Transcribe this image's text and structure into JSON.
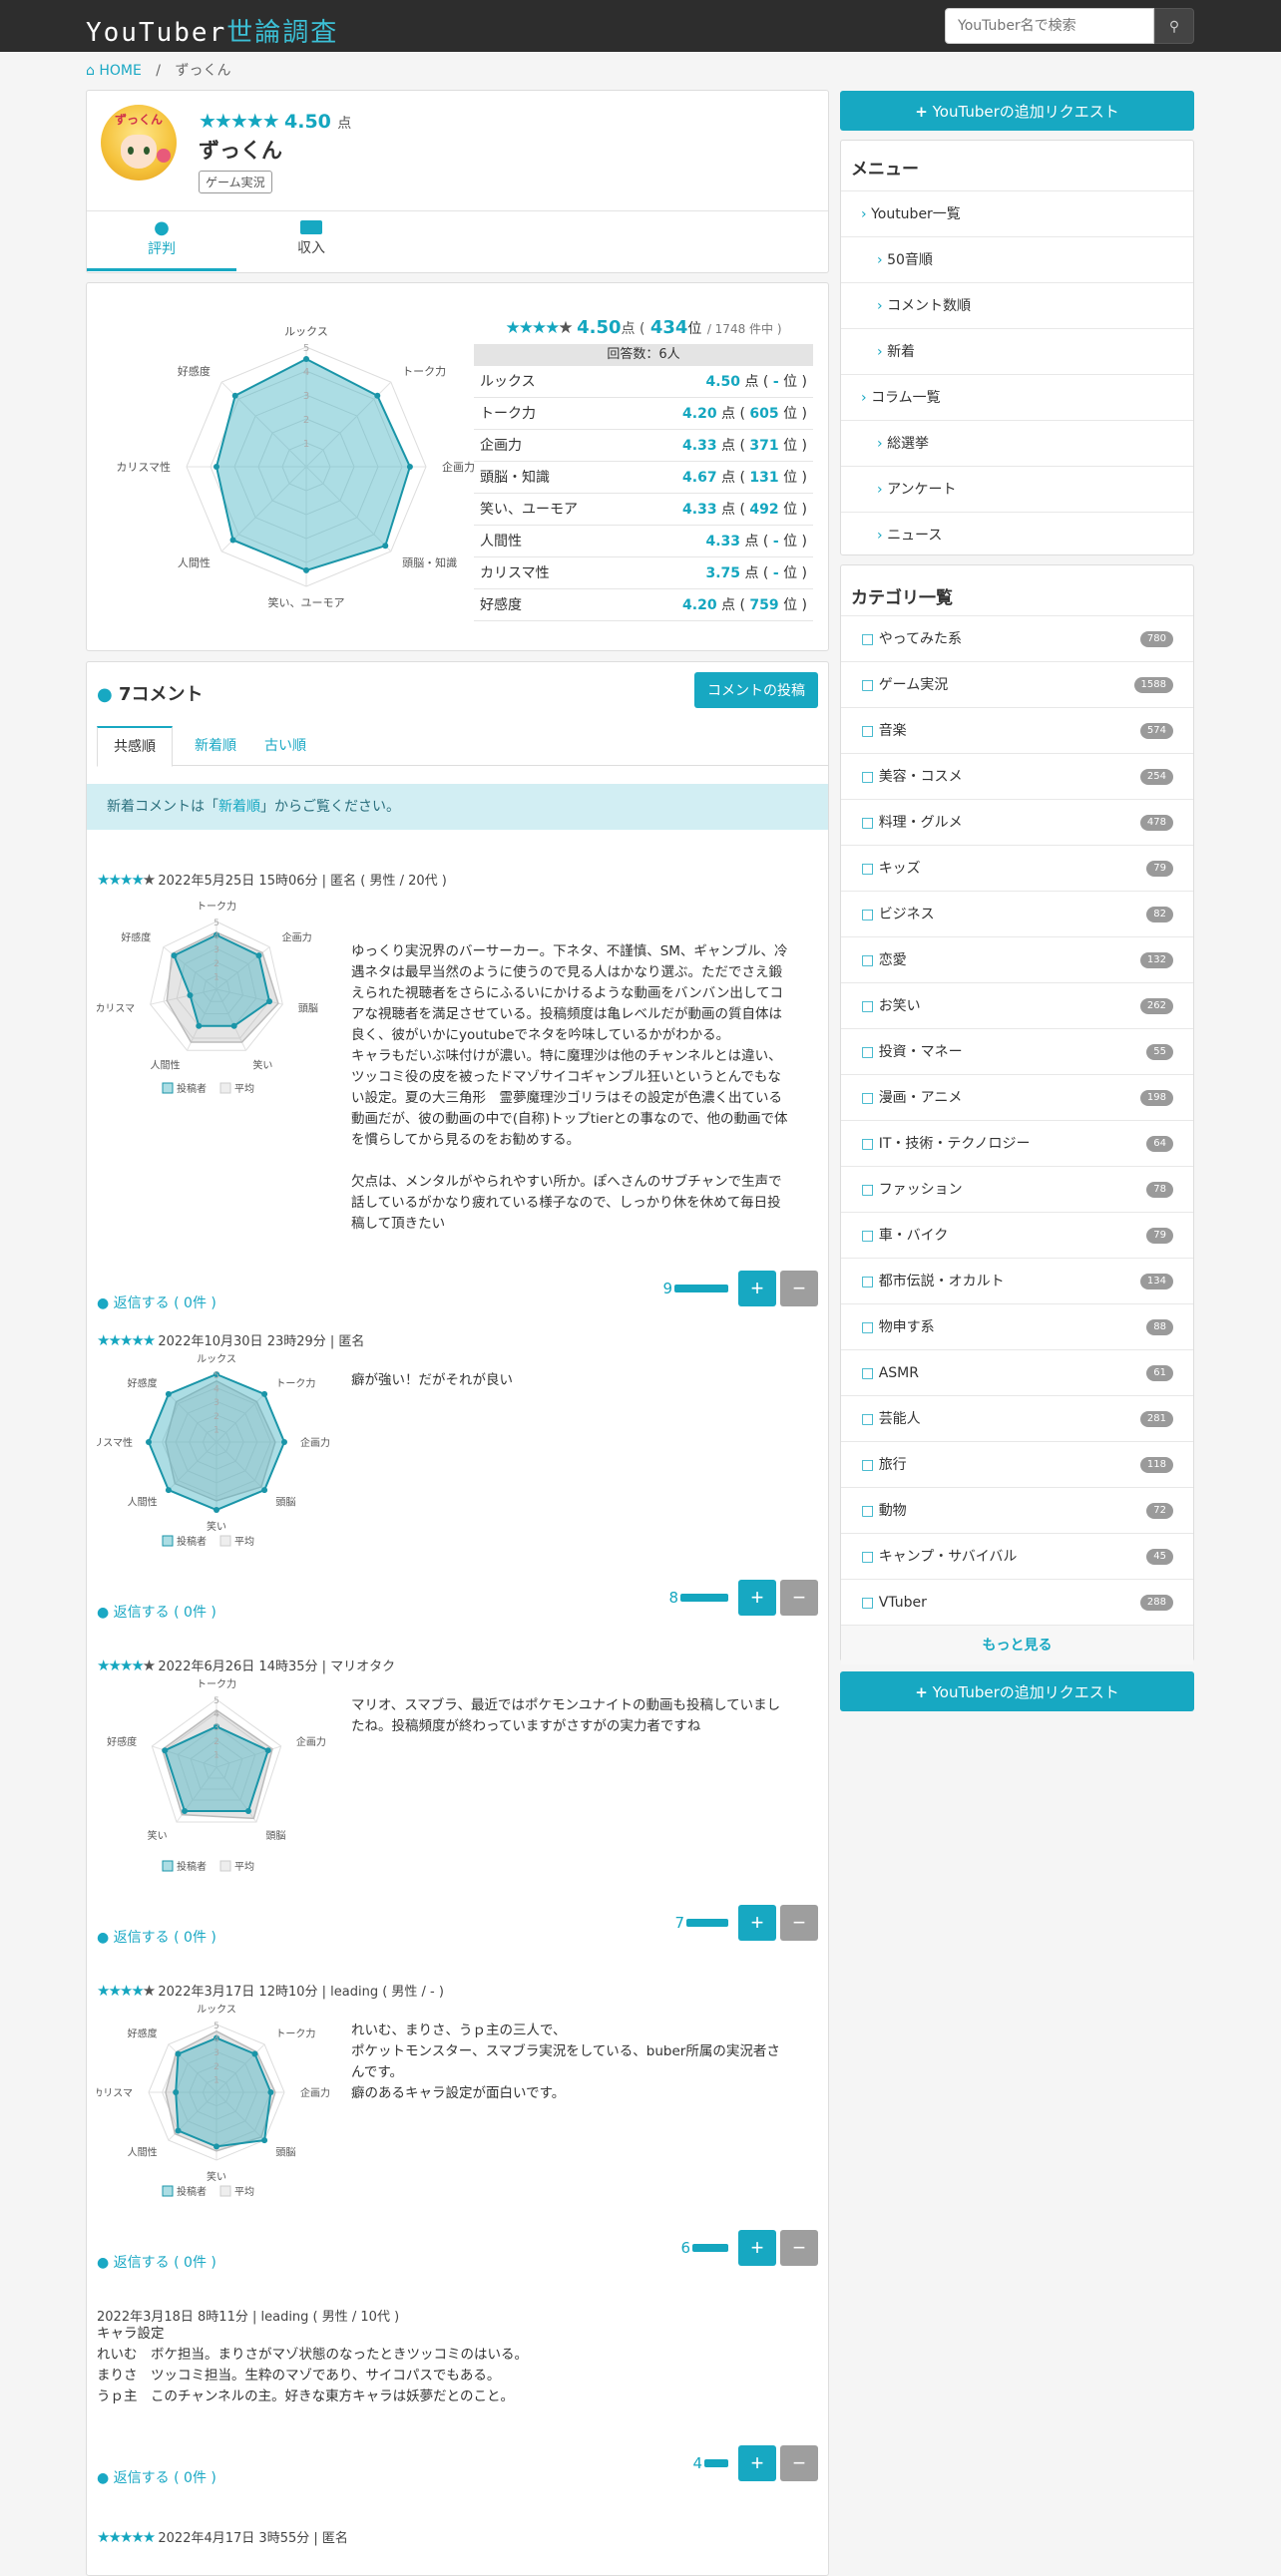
{
  "header": {
    "logo_a": "YouTuber",
    "logo_b": "世論調査",
    "search_placeholder": "YouTuber名で検索",
    "search_icon": "search-icon"
  },
  "breadcrumb": {
    "home": "HOME",
    "sep": "/",
    "current": "ずっくん"
  },
  "profile": {
    "avatar_text": "ずっくん",
    "stars": "★★★★★",
    "score": "4.50",
    "score_unit": "点",
    "name": "ずっくん",
    "category": "ゲーム実況",
    "tab_review": "評判",
    "tab_income": "収入"
  },
  "summary": {
    "score": "4.50",
    "unit": "点 (",
    "rank": "434",
    "rank_unit": "位",
    "of": "/ 1748 件中 )",
    "respondents": "回答数：6人",
    "rows": [
      {
        "label": "ルックス",
        "score": "4.50",
        "rank": "-"
      },
      {
        "label": "トーク力",
        "score": "4.20",
        "rank": "605"
      },
      {
        "label": "企画力",
        "score": "4.33",
        "rank": "371"
      },
      {
        "label": "頭脳・知識",
        "score": "4.67",
        "rank": "131"
      },
      {
        "label": "笑い、ユーモア",
        "score": "4.33",
        "rank": "492"
      },
      {
        "label": "人間性",
        "score": "4.33",
        "rank": "-"
      },
      {
        "label": "カリスマ性",
        "score": "3.75",
        "rank": "-"
      },
      {
        "label": "好感度",
        "score": "4.20",
        "rank": "759"
      }
    ],
    "radar_labels": [
      "ルックス",
      "トーク力",
      "企画力",
      "頭脳・知識",
      "笑い、ユーモア",
      "人間性",
      "カリスマ性",
      "好感度"
    ],
    "radar_values": [
      4.5,
      4.2,
      4.33,
      4.67,
      4.33,
      4.33,
      3.75,
      4.2
    ]
  },
  "comments": {
    "title": "7コメント",
    "post_button": "コメントの投稿",
    "tabs": [
      "共感順",
      "新着順",
      "古い順"
    ],
    "notice_a": "新着コメントは「",
    "notice_link": "新着順",
    "notice_b": "」からご覧ください。",
    "legend_poster": "投稿者",
    "legend_avg": "平均",
    "items": [
      {
        "stars": "★★★★",
        "stars_g": "★",
        "meta": "2022年5月25日 15時06分 | 匿名 ( 男性 / 20代 )",
        "body": "ゆっくり実況界のバーサーカー。下ネタ、不謹慎、SM、ギャンブル、冷遇ネタは最早当然のように使うので見る人はかなり選ぶ。ただでさえ鍛えられた視聴者をさらにふるいにかけるような動画をバンバン出してコアな視聴者を満足させている。投稿頻度は亀レベルだが動画の質自体は良く、彼がいかにyoutubeでネタを吟味しているかがわかる。\nキャラもだいぶ味付けが濃い。特に魔理沙は他のチャンネルとは違い、ツッコミ役の皮を被ったドマゾサイコギャンブル狂いというとんでもない設定。夏の大三角形　霊夢魔理沙ゴリラはその設定が色濃く出ている動画だが、彼の動画の中で(自称)トップtierとの事なので、他の動画で体を慣らしてから見るのをお勧めする。\n\n欠点は、メンタルがやられやすい所か。ぽへさんのサブチャンで生声で話しているがかなり疲れている様子なので、しっかり休を休めて毎日投稿して頂きたい",
        "reply": "返信する ( 0件 )",
        "votes": "9",
        "radar_labels": [
          "トーク力",
          "企画力",
          "頭脳",
          "笑い",
          "人間性",
          "カリスマ",
          "好感度"
        ],
        "radar_values": [
          4,
          4,
          4,
          3,
          3,
          2,
          4
        ]
      },
      {
        "stars": "★★★★★",
        "stars_g": "",
        "meta": "2022年10月30日 23時29分 | 匿名",
        "body": "癖が強い！だがそれが良い",
        "reply": "返信する ( 0件 )",
        "votes": "8",
        "radar_labels": [
          "ルックス",
          "トーク力",
          "企画力",
          "頭脳",
          "笑い",
          "人間性",
          "カリスマ性",
          "好感度"
        ],
        "radar_values": [
          5,
          5,
          5,
          5,
          5,
          5,
          5,
          5
        ]
      },
      {
        "stars": "★★★★",
        "stars_g": "★",
        "meta": "2022年6月26日 14時35分 | マリオタク",
        "body": "マリオ、スマブラ、最近ではポケモンユナイトの動画も投稿していましたね。投稿頻度が終わっていますがさすがの実力者ですね",
        "reply": "返信する ( 0件 )",
        "votes": "7",
        "radar_labels": [
          "トーク力",
          "企画力",
          "頭脳",
          "笑い",
          "好感度"
        ],
        "radar_values": [
          3,
          4,
          4,
          4,
          4
        ]
      },
      {
        "stars": "★★★★",
        "stars_g": "★",
        "meta": "2022年3月17日 12時10分 | leading ( 男性 / - )",
        "body": "れいむ、まりさ、うｐ主の三人で、\nポケットモンスター、スマブラ実況をしている、buber所属の実況者さんです。\n癖のあるキャラ設定が面白いです。",
        "reply": "返信する ( 0件 )",
        "votes": "6",
        "radar_labels": [
          "ルックス",
          "トーク力",
          "企画力",
          "頭脳",
          "笑い",
          "人間性",
          "カリスマ",
          "好感度"
        ],
        "radar_values": [
          4,
          4,
          4,
          5,
          4,
          4,
          3,
          4
        ]
      },
      {
        "stars": "",
        "stars_g": "",
        "meta": "2022年3月18日 8時11分 | leading ( 男性 / 10代 )",
        "body": "キャラ設定\nれいむ　ボケ担当。まりさがマゾ状態のなったときツッコミのはいる。\nまりさ　ツッコミ担当。生粋のマゾであり、サイコパスでもある。\nうｐ主　このチャンネルの主。好きな東方キャラは妖夢だとのこと。",
        "reply": "返信する ( 0件 )",
        "votes": "4"
      },
      {
        "stars": "★★★★★",
        "stars_g": "",
        "meta": "2022年4月17日 3時55分 | 匿名"
      }
    ]
  },
  "sidebar": {
    "request_button": "YouTuberの追加リクエスト",
    "menu_title": "メニュー",
    "menu": [
      {
        "label": "Youtuber一覧",
        "indent": 0
      },
      {
        "label": "50音順",
        "indent": 1
      },
      {
        "label": "コメント数順",
        "indent": 1
      },
      {
        "label": "新着",
        "indent": 1
      },
      {
        "label": "コラム一覧",
        "indent": 0
      },
      {
        "label": "総選挙",
        "indent": 1
      },
      {
        "label": "アンケート",
        "indent": 1
      },
      {
        "label": "ニュース",
        "indent": 1
      }
    ],
    "category_title": "カテゴリ一覧",
    "categories": [
      {
        "label": "やってみた系",
        "count": "780"
      },
      {
        "label": "ゲーム実況",
        "count": "1588"
      },
      {
        "label": "音楽",
        "count": "574"
      },
      {
        "label": "美容・コスメ",
        "count": "254"
      },
      {
        "label": "料理・グルメ",
        "count": "478"
      },
      {
        "label": "キッズ",
        "count": "79"
      },
      {
        "label": "ビジネス",
        "count": "82"
      },
      {
        "label": "恋愛",
        "count": "132"
      },
      {
        "label": "お笑い",
        "count": "262"
      },
      {
        "label": "投資・マネー",
        "count": "55"
      },
      {
        "label": "漫画・アニメ",
        "count": "198"
      },
      {
        "label": "IT・技術・テクノロジー",
        "count": "64"
      },
      {
        "label": "ファッション",
        "count": "78"
      },
      {
        "label": "車・バイク",
        "count": "79"
      },
      {
        "label": "都市伝説・オカルト",
        "count": "134"
      },
      {
        "label": "物申す系",
        "count": "88"
      },
      {
        "label": "ASMR",
        "count": "61"
      },
      {
        "label": "芸能人",
        "count": "281"
      },
      {
        "label": "旅行",
        "count": "118"
      },
      {
        "label": "動物",
        "count": "72"
      },
      {
        "label": "キャンプ・サバイバル",
        "count": "45"
      },
      {
        "label": "VTuber",
        "count": "288"
      }
    ],
    "more": "もっと見る"
  },
  "colors": {
    "accent": "#17a8c2",
    "radar_fill": "#7fcfd9",
    "topbar": "#2d2d2d"
  }
}
